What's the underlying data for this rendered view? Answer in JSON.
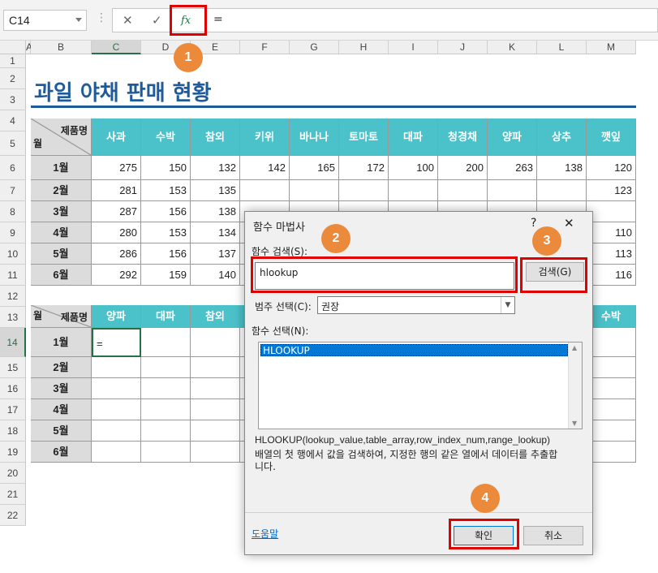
{
  "formula_bar": {
    "cell_ref": "C14",
    "formula": "=",
    "cancel": "✕",
    "confirm": "✓",
    "fx": "fx"
  },
  "columns": [
    "A",
    "B",
    "C",
    "D",
    "E",
    "F",
    "G",
    "H",
    "I",
    "J",
    "K",
    "L",
    "M"
  ],
  "rows": [
    "1",
    "2",
    "3",
    "4",
    "5",
    "6",
    "7",
    "8",
    "9",
    "10",
    "11",
    "12",
    "13",
    "14",
    "15",
    "16",
    "17",
    "18",
    "19",
    "20",
    "21",
    "22"
  ],
  "sheet": {
    "title": "과일 야채 판매 현황",
    "corner_top": "제품명",
    "corner_bottom": "월",
    "table1_headers": [
      "사과",
      "수박",
      "참외",
      "키위",
      "바나나",
      "토마토",
      "대파",
      "청경채",
      "양파",
      "상추",
      "깻잎"
    ],
    "table1_rows": [
      {
        "month": "1월",
        "vals": [
          "275",
          "150",
          "132",
          "142",
          "165",
          "172",
          "100",
          "200",
          "263",
          "138",
          "120"
        ]
      },
      {
        "month": "2월",
        "vals": [
          "281",
          "153",
          "135",
          "",
          "",
          "",
          "",
          "",
          "",
          "",
          "123"
        ]
      },
      {
        "month": "3월",
        "vals": [
          "287",
          "156",
          "138",
          "",
          "",
          "",
          "",
          "",
          "",
          "",
          ""
        ]
      },
      {
        "month": "4월",
        "vals": [
          "280",
          "153",
          "134",
          "",
          "",
          "",
          "",
          "",
          "",
          "",
          "110"
        ]
      },
      {
        "month": "5월",
        "vals": [
          "286",
          "156",
          "137",
          "",
          "",
          "",
          "",
          "",
          "",
          "",
          "113"
        ]
      },
      {
        "month": "6월",
        "vals": [
          "292",
          "159",
          "140",
          "",
          "",
          "",
          "",
          "",
          "",
          "",
          "116"
        ]
      }
    ],
    "table2_headers": [
      "양파",
      "대파",
      "참외",
      "",
      "",
      "",
      "",
      "",
      "",
      "",
      "수박"
    ],
    "table2_months": [
      "1월",
      "2월",
      "3월",
      "4월",
      "5월",
      "6월"
    ],
    "active_cell_value": "="
  },
  "dialog": {
    "title": "함수 마법사",
    "help": "?",
    "close": "✕",
    "search_label": "함수 검색(S):",
    "search_value": "hlookup",
    "search_button": "검색(G)",
    "category_label": "범주 선택(C):",
    "category_value": "권장",
    "select_label": "함수 선택(N):",
    "functions": [
      "HLOOKUP"
    ],
    "signature": "HLOOKUP(lookup_value,table_array,row_index_num,range_lookup)",
    "description": "배열의 첫 행에서 값을 검색하여, 지정한 행의 같은 열에서 데이터를 추출합니다.",
    "help_link": "도움말",
    "ok": "확인",
    "cancel": "취소"
  },
  "badges": [
    "1",
    "2",
    "3",
    "4"
  ]
}
